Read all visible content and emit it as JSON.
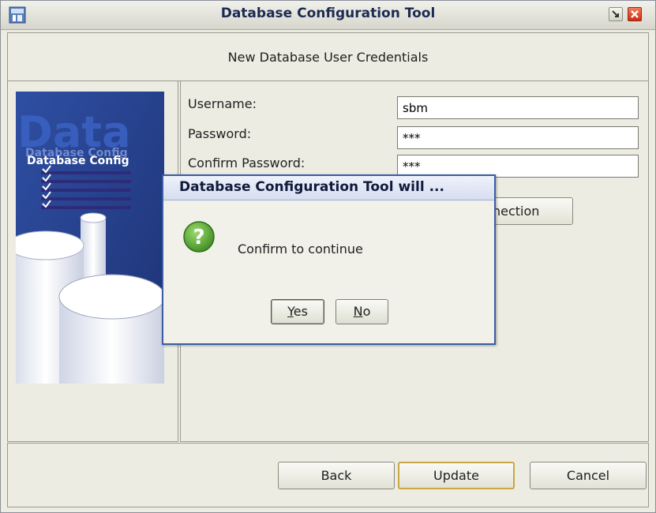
{
  "window": {
    "title": "Database Configuration Tool"
  },
  "header": {
    "text": "New Database User Credentials"
  },
  "banner": {
    "big_text": "Data",
    "caption": "Database Config",
    "caption_shadow": "Database Config"
  },
  "form": {
    "username_label": "Username:",
    "username_value": "sbm",
    "password_label": "Password:",
    "password_value": "***",
    "confirm_label": "Confirm Password:",
    "confirm_value": "***",
    "test_button_label": "nection"
  },
  "footer": {
    "back_label": "Back",
    "update_label": "Update",
    "cancel_label": "Cancel"
  },
  "dialog": {
    "title": "Database Configuration Tool will ...",
    "message": "Confirm to continue",
    "yes_prefix": "Y",
    "yes_rest": "es",
    "no_prefix": "N",
    "no_rest": "o"
  },
  "colors": {
    "title_text": "#1c2a52",
    "dialog_border": "#3c5da6",
    "question_icon": "#5ea83c",
    "default_button_border": "#c9a646"
  },
  "icons": {
    "app": "app-icon",
    "minimize": "minimize-icon",
    "close": "close-icon",
    "question": "question-icon"
  }
}
